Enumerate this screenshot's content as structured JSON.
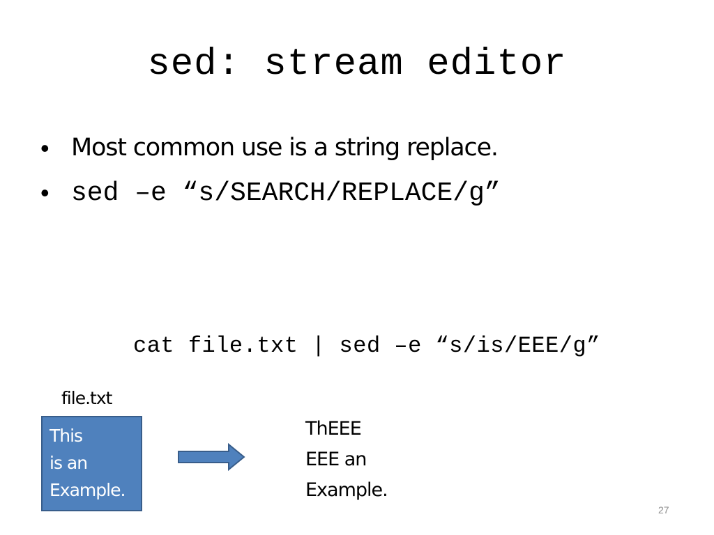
{
  "slide": {
    "title": "sed: stream editor",
    "bullets": [
      "Most common use is a string replace.",
      "sed –e “s/SEARCH/REPLACE/g”"
    ],
    "bullet_glyph": "•",
    "command": "cat file.txt | sed –e “s/is/EEE/g”",
    "input_file": {
      "label": "file.txt",
      "lines": [
        "This",
        "is an",
        "Example."
      ]
    },
    "arrow_icon": "right-arrow-icon",
    "output_lines": [
      "ThEEE",
      "EEE an",
      "Example."
    ],
    "page_number": "27",
    "colors": {
      "box_fill": "#4f81bd",
      "box_border": "#385d8a",
      "box_text": "#ffffff"
    }
  }
}
